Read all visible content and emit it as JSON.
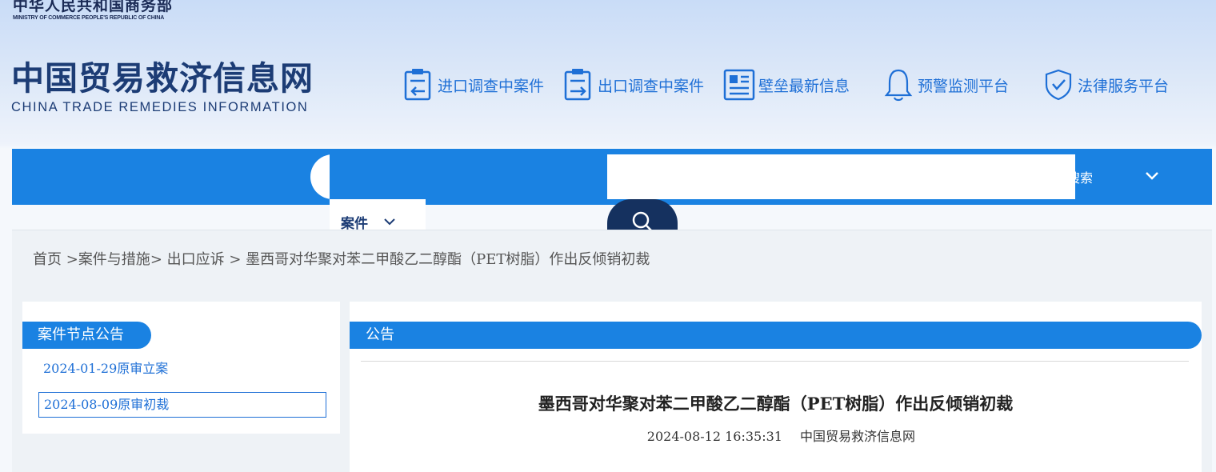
{
  "header": {
    "ministry_cn": "中华人民共和国商务部",
    "ministry_en": "MINISTRY OF COMMERCE PEOPLE'S REPUBLIC OF CHINA",
    "site_name_cn": "中国贸易救济信息网",
    "site_name_en": "CHINA TRADE REMEDIES INFORMATION"
  },
  "topnav": {
    "items": [
      {
        "label": "进口调查中案件",
        "icon": "import-case-icon"
      },
      {
        "label": "出口调查中案件",
        "icon": "export-case-icon"
      },
      {
        "label": "壁垒最新信息",
        "icon": "barrier-news-icon"
      },
      {
        "label": "预警监测平台",
        "icon": "bell-icon"
      },
      {
        "label": "法律服务平台",
        "icon": "shield-check-icon"
      }
    ]
  },
  "search": {
    "type_selected": "案件",
    "input_value": "",
    "tail_text": "搜索"
  },
  "breadcrumb": {
    "home": "首页",
    "sep1": " >",
    "level1": "案件与措施",
    "sep2": "> ",
    "level2": "出口应诉",
    "sep3": " > ",
    "current": "墨西哥对华聚对苯二甲酸乙二醇酯（PET树脂）作出反倾销初裁"
  },
  "left_panel": {
    "title": "案件节点公告",
    "items": [
      {
        "label": "2024-01-29原审立案"
      },
      {
        "label": "2024-08-09原审初裁"
      }
    ]
  },
  "right_panel": {
    "title": "公告",
    "article_title": "墨西哥对华聚对苯二甲酸乙二醇酯（PET树脂）作出反倾销初裁",
    "date": "2024-08-12 16:35:31",
    "source": "中国贸易救济信息网"
  },
  "colors": {
    "primary_blue": "#1a82e2",
    "dark_navy": "#15315f",
    "link_blue": "#1e6fd6"
  }
}
